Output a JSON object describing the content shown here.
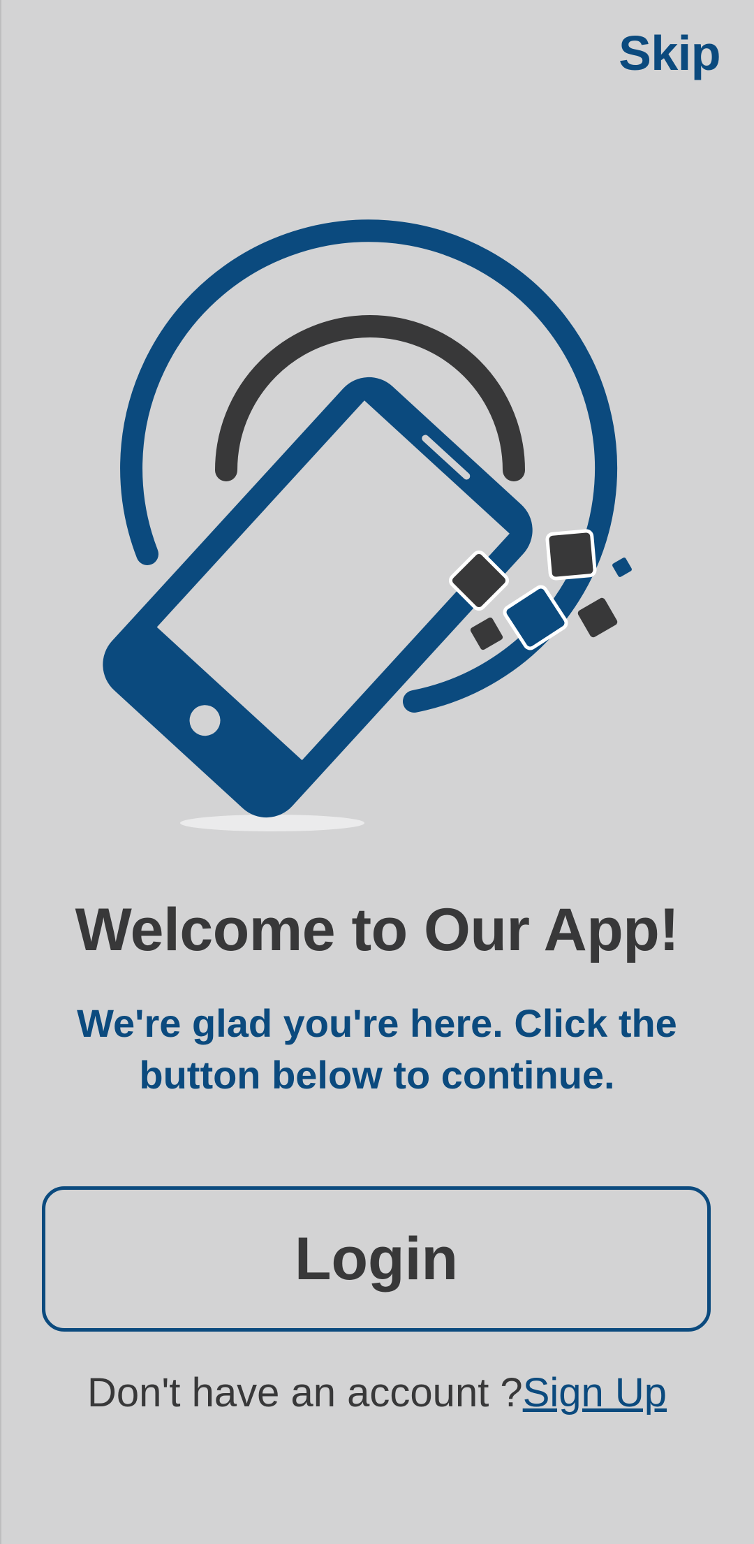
{
  "header": {
    "skip_label": "Skip"
  },
  "illustration": {
    "icon": "rotating-phone-icon",
    "colors": {
      "primary": "#0b4a7e",
      "dark": "#383839",
      "background": "#d3d3d4"
    }
  },
  "welcome": {
    "title": "Welcome to Our App!",
    "subtitle": "We're glad you're here. Click the button below to continue."
  },
  "actions": {
    "login_label": "Login",
    "signup_prompt": "Don't have an account ?",
    "signup_label": "Sign Up"
  }
}
